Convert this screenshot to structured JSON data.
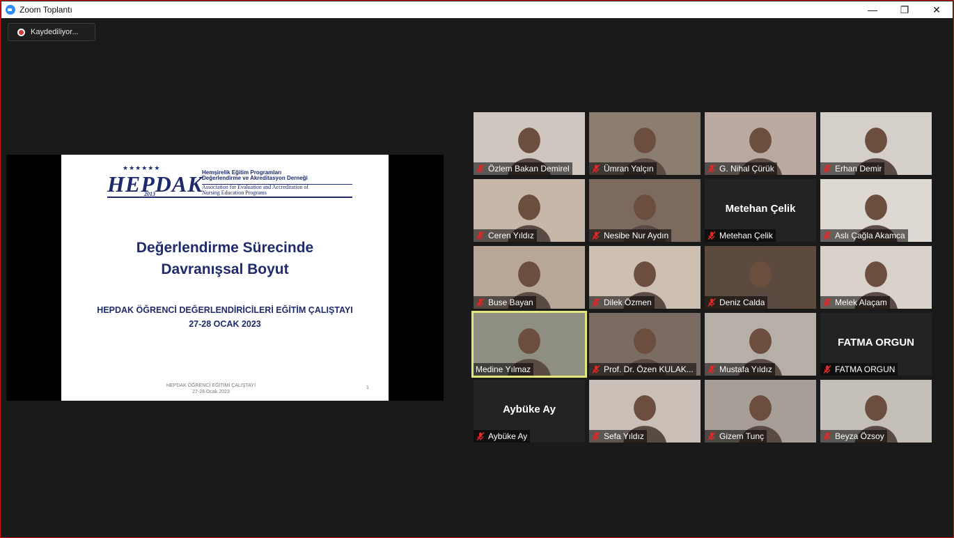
{
  "window": {
    "title": "Zoom Toplantı",
    "minimize": "—",
    "restore": "❐",
    "close": "✕"
  },
  "recording": {
    "label": "Kaydediliyor..."
  },
  "slide": {
    "logo": {
      "name": "HEPDAK",
      "year": "2013",
      "line1": "Hemşirelik Eğitim Programları",
      "line2": "Değerlendirme ve Akreditasyon Derneği",
      "line3": "Association for Evaluation and Accreditation of",
      "line4": "Nursing Education Programs"
    },
    "title_line1": "Değerlendirme Sürecinde",
    "title_line2": "Davranışsal Boyut",
    "subtitle_line1": "HEPDAK ÖĞRENCİ DEĞERLENDİRİCİLERİ EĞİTİM ÇALIŞTAYI",
    "subtitle_line2": "27-28 OCAK 2023",
    "footer_line1": "HEPDAK ÖĞRENCİ EĞİTİMİ ÇALIŞTAYI",
    "footer_line2": "27-28 Ocak 2023",
    "page_number": "1"
  },
  "participants": [
    {
      "name": "Özlem Bakan Demirel",
      "video": true,
      "muted": true,
      "bg": "#cfc6bf"
    },
    {
      "name": "Ümran Yalçın",
      "video": true,
      "muted": true,
      "bg": "#8b7d70"
    },
    {
      "name": "G. Nihal Çürük",
      "video": true,
      "muted": true,
      "bg": "#b9a9a0"
    },
    {
      "name": "Erhan Demir",
      "video": true,
      "muted": true,
      "bg": "#d4cfc8"
    },
    {
      "name": "Ceren Yıldız",
      "video": true,
      "muted": true,
      "bg": "#c7b7a9"
    },
    {
      "name": "Nesibe Nur Aydın",
      "video": true,
      "muted": true,
      "bg": "#7d6a5e"
    },
    {
      "name": "Metehan Çelik",
      "video": false,
      "muted": true,
      "bg": "#232323"
    },
    {
      "name": "Aslı Çağla Akamca",
      "video": true,
      "muted": true,
      "bg": "#ddd8d2"
    },
    {
      "name": "Buse Bayan",
      "video": true,
      "muted": true,
      "bg": "#b8a697"
    },
    {
      "name": "Dilek Özmen",
      "video": true,
      "muted": true,
      "bg": "#cdbfb2"
    },
    {
      "name": "Deniz Calda",
      "video": true,
      "muted": true,
      "bg": "#5c4a3f"
    },
    {
      "name": "Melek Alaçam",
      "video": true,
      "muted": true,
      "bg": "#d9d2ca"
    },
    {
      "name": "Medine Yılmaz",
      "video": true,
      "muted": false,
      "active": true,
      "bg": "#8e8f82"
    },
    {
      "name": "Prof. Dr. Özen KULAK...",
      "video": true,
      "muted": true,
      "bg": "#7a6b63"
    },
    {
      "name": "Mustafa Yıldız",
      "video": true,
      "muted": true,
      "bg": "#b5afa8"
    },
    {
      "name": "FATMA ORGUN",
      "video": false,
      "muted": true,
      "bg": "#232323"
    },
    {
      "name": "Aybüke Ay",
      "video": false,
      "muted": true,
      "bg": "#232323"
    },
    {
      "name": "Sefa Yıldız",
      "video": true,
      "muted": true,
      "bg": "#c9bfb6"
    },
    {
      "name": "Gizem Tunç",
      "video": true,
      "muted": true,
      "bg": "#a79f97"
    },
    {
      "name": "Beyza Özsoy",
      "video": true,
      "muted": true,
      "bg": "#c4c0b8"
    }
  ],
  "colors": {
    "border": "#d0121b",
    "active_speaker": "#e3e67a",
    "muted_mic": "#e02828",
    "slide_text": "#1f2b6a"
  }
}
